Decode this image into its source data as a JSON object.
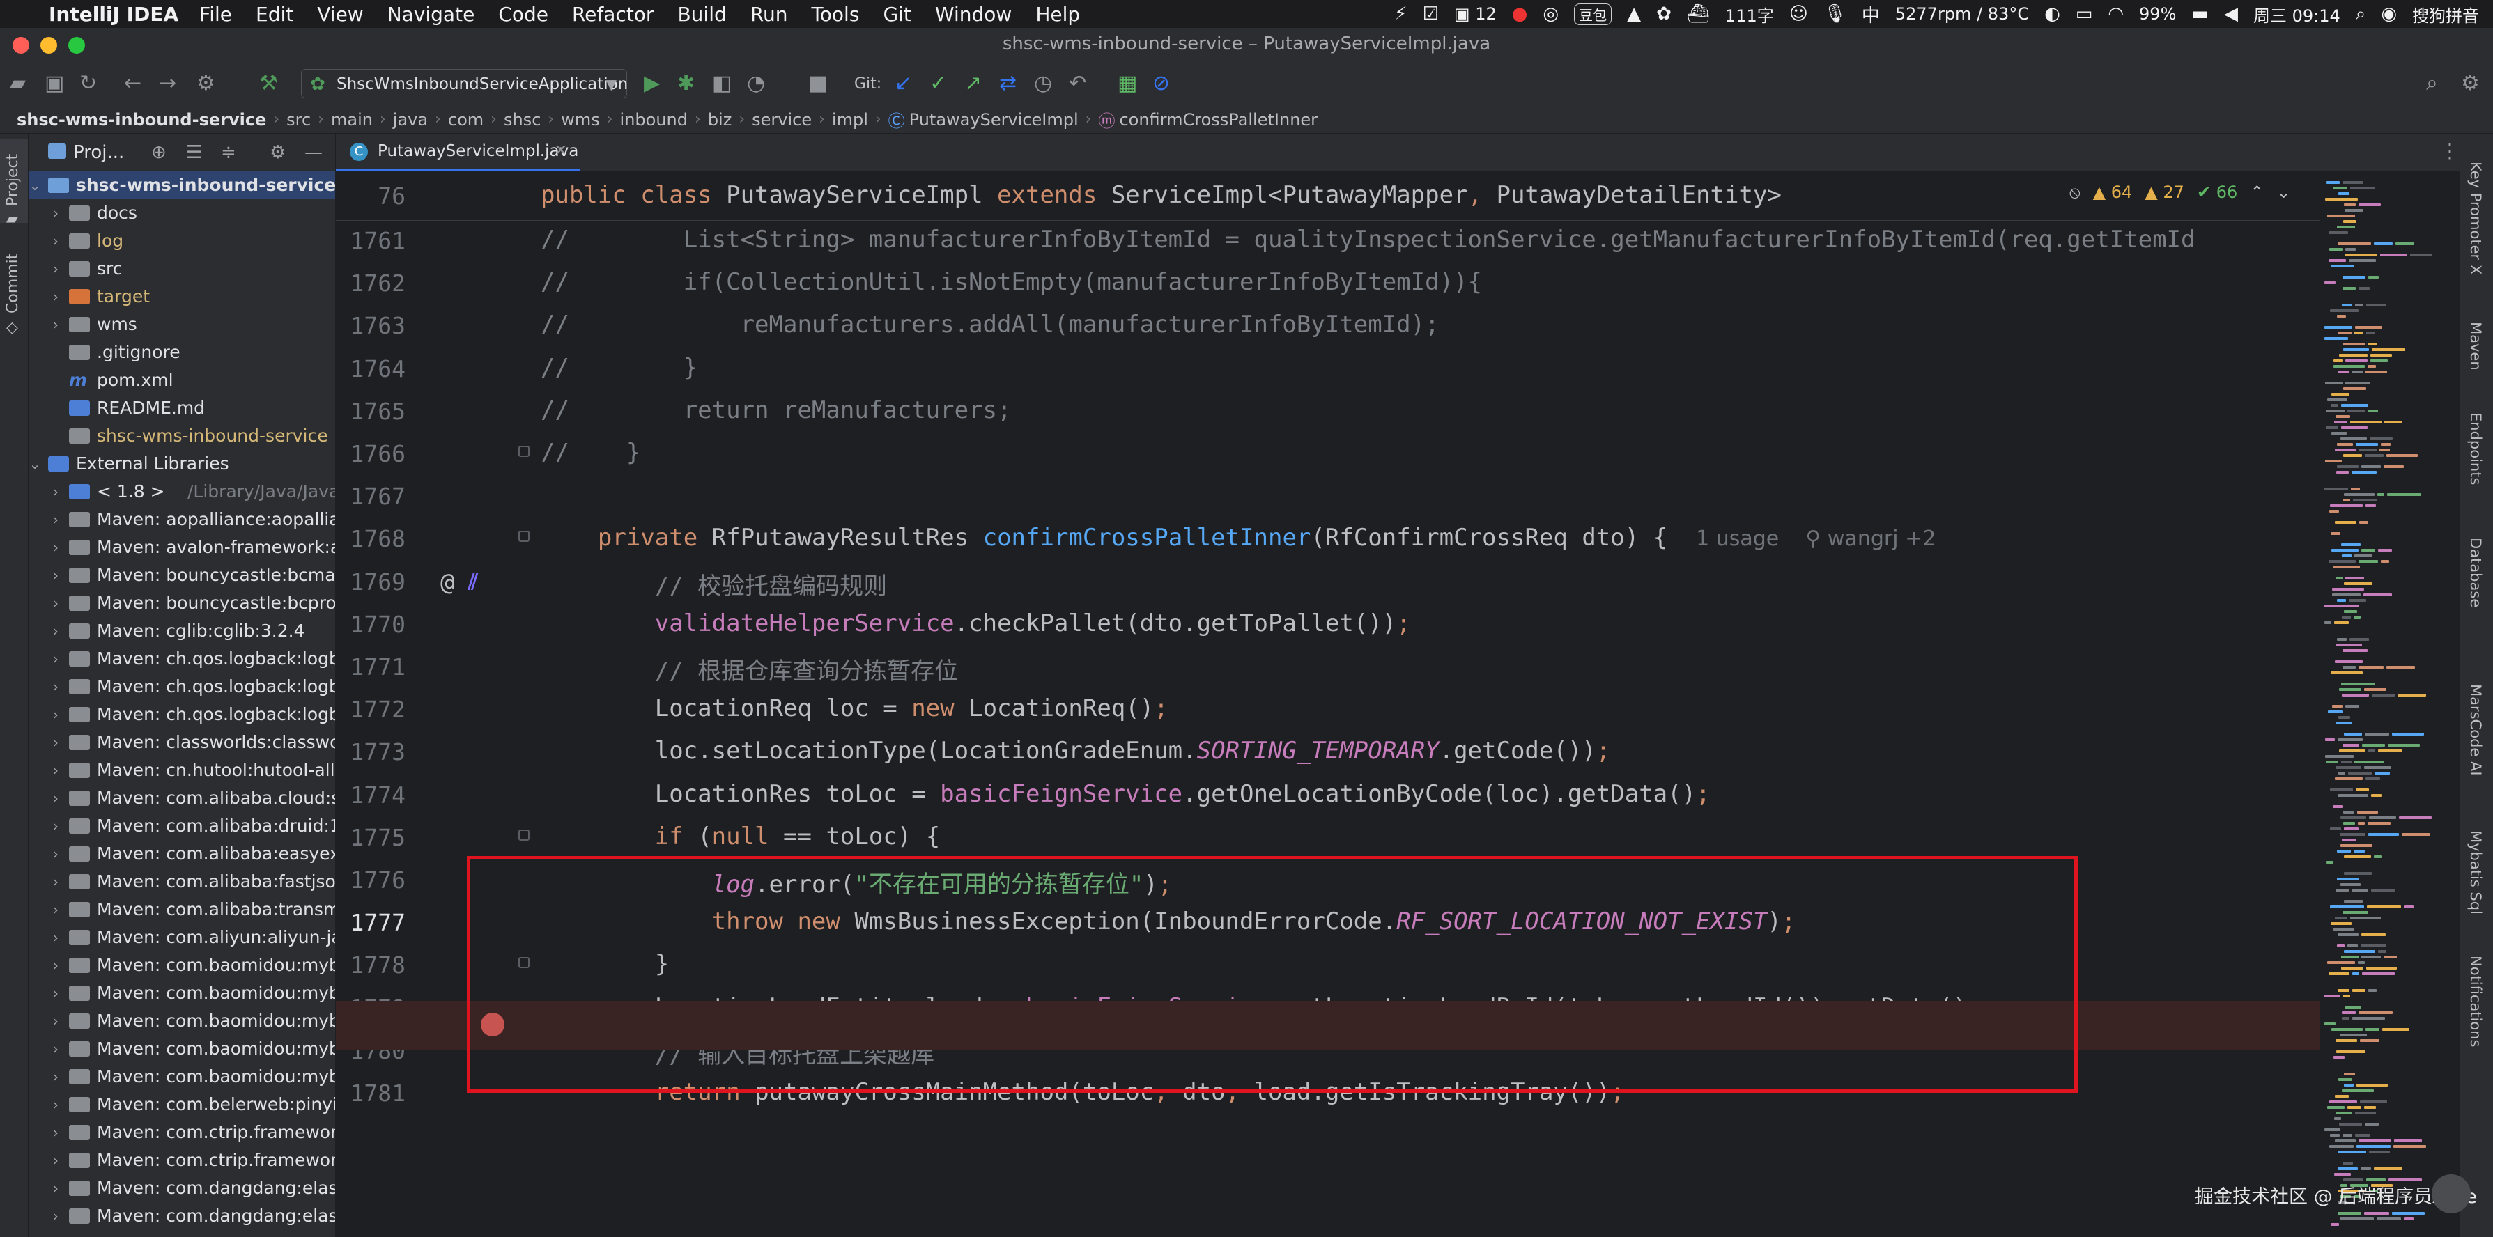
{
  "menubar": {
    "app": "IntelliJ IDEA",
    "items": [
      "File",
      "Edit",
      "View",
      "Navigate",
      "Code",
      "Refactor",
      "Build",
      "Run",
      "Tools",
      "Git",
      "Window",
      "Help"
    ],
    "status": {
      "notif_count": "12",
      "douban": "豆包",
      "word_count": "111字",
      "fan": "5277rpm / 83°C",
      "battery": "99%",
      "clock": "周三 09:14",
      "ime": "搜狗拼音"
    }
  },
  "window": {
    "title": "shsc-wms-inbound-service – PutawayServiceImpl.java"
  },
  "toolbar": {
    "run_config": "ShscWmsInboundServiceApplication",
    "git_label": "Git:"
  },
  "breadcrumb": [
    "shsc-wms-inbound-service",
    "src",
    "main",
    "java",
    "com",
    "shsc",
    "wms",
    "inbound",
    "biz",
    "service",
    "impl",
    "PutawayServiceImpl",
    "confirmCrossPalletInner"
  ],
  "project": {
    "header": "Proj...",
    "tree": [
      {
        "label": "shsc-wms-inbound-service",
        "depth": 0,
        "expanded": true,
        "kind": "module",
        "bold": true
      },
      {
        "label": "docs",
        "depth": 1,
        "expanded": false,
        "kind": "folder"
      },
      {
        "label": "log",
        "depth": 1,
        "expanded": false,
        "kind": "folder-excluded",
        "color": "#d5b778"
      },
      {
        "label": "src",
        "depth": 1,
        "expanded": false,
        "kind": "folder"
      },
      {
        "label": "target",
        "depth": 1,
        "expanded": false,
        "kind": "folder-target",
        "color": "#d5b778"
      },
      {
        "label": "wms",
        "depth": 1,
        "expanded": false,
        "kind": "folder"
      },
      {
        "label": ".gitignore",
        "depth": 1,
        "kind": "file"
      },
      {
        "label": "pom.xml",
        "depth": 1,
        "kind": "maven"
      },
      {
        "label": "README.md",
        "depth": 1,
        "kind": "md"
      },
      {
        "label": "shsc-wms-inbound-service",
        "depth": 1,
        "kind": "iml",
        "color": "#d5b778"
      },
      {
        "label": "External Libraries",
        "depth": 0,
        "expanded": true,
        "kind": "lib"
      },
      {
        "label": "< 1.8 >",
        "extra": "/Library/Java/JavaV",
        "depth": 1,
        "expanded": false,
        "kind": "jdk"
      },
      {
        "label": "Maven: aopalliance:aopallia",
        "depth": 1,
        "expanded": false,
        "kind": "jar"
      },
      {
        "label": "Maven: avalon-framework:a",
        "depth": 1,
        "expanded": false,
        "kind": "jar"
      },
      {
        "label": "Maven: bouncycastle:bcma",
        "depth": 1,
        "expanded": false,
        "kind": "jar"
      },
      {
        "label": "Maven: bouncycastle:bcpro",
        "depth": 1,
        "expanded": false,
        "kind": "jar"
      },
      {
        "label": "Maven: cglib:cglib:3.2.4",
        "depth": 1,
        "expanded": false,
        "kind": "jar"
      },
      {
        "label": "Maven: ch.qos.logback:logb",
        "depth": 1,
        "expanded": false,
        "kind": "jar"
      },
      {
        "label": "Maven: ch.qos.logback:logb",
        "depth": 1,
        "expanded": false,
        "kind": "jar"
      },
      {
        "label": "Maven: ch.qos.logback:logb",
        "depth": 1,
        "expanded": false,
        "kind": "jar"
      },
      {
        "label": "Maven: classworlds:classwo",
        "depth": 1,
        "expanded": false,
        "kind": "jar"
      },
      {
        "label": "Maven: cn.hutool:hutool-all",
        "depth": 1,
        "expanded": false,
        "kind": "jar"
      },
      {
        "label": "Maven: com.alibaba.cloud:s",
        "depth": 1,
        "expanded": false,
        "kind": "jar"
      },
      {
        "label": "Maven: com.alibaba:druid:1",
        "depth": 1,
        "expanded": false,
        "kind": "jar"
      },
      {
        "label": "Maven: com.alibaba:easyex",
        "depth": 1,
        "expanded": false,
        "kind": "jar"
      },
      {
        "label": "Maven: com.alibaba:fastjso",
        "depth": 1,
        "expanded": false,
        "kind": "jar"
      },
      {
        "label": "Maven: com.alibaba:transm",
        "depth": 1,
        "expanded": false,
        "kind": "jar"
      },
      {
        "label": "Maven: com.aliyun:aliyun-ja",
        "depth": 1,
        "expanded": false,
        "kind": "jar"
      },
      {
        "label": "Maven: com.baomidou:myb",
        "depth": 1,
        "expanded": false,
        "kind": "jar"
      },
      {
        "label": "Maven: com.baomidou:myb",
        "depth": 1,
        "expanded": false,
        "kind": "jar"
      },
      {
        "label": "Maven: com.baomidou:myb",
        "depth": 1,
        "expanded": false,
        "kind": "jar"
      },
      {
        "label": "Maven: com.baomidou:myb",
        "depth": 1,
        "expanded": false,
        "kind": "jar"
      },
      {
        "label": "Maven: com.baomidou:myb",
        "depth": 1,
        "expanded": false,
        "kind": "jar"
      },
      {
        "label": "Maven: com.belerweb:pinyi",
        "depth": 1,
        "expanded": false,
        "kind": "jar"
      },
      {
        "label": "Maven: com.ctrip.framewor",
        "depth": 1,
        "expanded": false,
        "kind": "jar"
      },
      {
        "label": "Maven: com.ctrip.framewor",
        "depth": 1,
        "expanded": false,
        "kind": "jar"
      },
      {
        "label": "Maven: com.dangdang:elas",
        "depth": 1,
        "expanded": false,
        "kind": "jar"
      },
      {
        "label": "Maven: com.dangdang:elas",
        "depth": 1,
        "expanded": false,
        "kind": "jar"
      }
    ]
  },
  "left_strip": {
    "project": "Project",
    "commit": "Commit"
  },
  "right_strip": [
    "Key Promoter X",
    "Maven",
    "Endpoints",
    "Database",
    "MarsCode AI",
    "Mybatis Sql",
    "Notifications"
  ],
  "editor": {
    "tab": "PutawayServiceImpl.java",
    "inspections": {
      "warnings": "64",
      "weak": "27",
      "ok": "66"
    },
    "sticky": {
      "line": "76"
    },
    "current_line": "1777",
    "breakpoint_line": "1777",
    "lines": [
      {
        "n": "1761",
        "tokens": [
          [
            "cm",
            "//        List<String> manufacturerInfoByItemId = qualityInspectionService.getManufacturerInfoByItemId(req.getItemId"
          ]
        ]
      },
      {
        "n": "1762",
        "tokens": [
          [
            "cm",
            "//        if(CollectionUtil.isNotEmpty(manufacturerInfoByItemId)){"
          ]
        ]
      },
      {
        "n": "1763",
        "tokens": [
          [
            "cm",
            "//            reManufacturers.addAll(manufacturerInfoByItemId);"
          ]
        ]
      },
      {
        "n": "1764",
        "tokens": [
          [
            "cm",
            "//        }"
          ]
        ]
      },
      {
        "n": "1765",
        "tokens": [
          [
            "cm",
            "//        return reManufacturers;"
          ]
        ]
      },
      {
        "n": "1766",
        "tokens": [
          [
            "cm",
            "//    }"
          ]
        ]
      },
      {
        "n": "1767",
        "tokens": []
      },
      {
        "n": "1768",
        "tokens": [
          [
            "",
            "    "
          ],
          [
            "kw",
            "private "
          ],
          [
            "",
            "RfPutawayResultRes "
          ],
          [
            "fn",
            "confirmCrossPalletInner"
          ],
          [
            "",
            "(RfConfirmCrossReq dto) {  "
          ],
          [
            "inlay",
            "1 usage    ⚲ wangrj +2"
          ]
        ]
      },
      {
        "n": "1769",
        "tokens": [
          [
            "",
            "        "
          ],
          [
            "cmt",
            "// 校验托盘编码规则"
          ]
        ]
      },
      {
        "n": "1770",
        "tokens": [
          [
            "",
            "        "
          ],
          [
            "fld",
            "validateHelperService"
          ],
          [
            "",
            ".checkPallet(dto.getToPallet())"
          ],
          [
            "kw",
            ";"
          ]
        ]
      },
      {
        "n": "1771",
        "tokens": [
          [
            "",
            "        "
          ],
          [
            "cmt",
            "// 根据仓库查询分拣暂存位"
          ]
        ]
      },
      {
        "n": "1772",
        "tokens": [
          [
            "",
            "        LocationReq loc = "
          ],
          [
            "kw",
            "new "
          ],
          [
            "",
            "LocationReq()"
          ],
          [
            "kw",
            ";"
          ]
        ]
      },
      {
        "n": "1773",
        "tokens": [
          [
            "",
            "        loc.setLocationType(LocationGradeEnum."
          ],
          [
            "itf",
            "SORTING_TEMPORARY"
          ],
          [
            "",
            ".getCode())"
          ],
          [
            "kw",
            ";"
          ]
        ]
      },
      {
        "n": "1774",
        "tokens": [
          [
            "",
            "        LocationRes toLoc = "
          ],
          [
            "fld",
            "basicFeignService"
          ],
          [
            "",
            ".getOneLocationByCode(loc).getData()"
          ],
          [
            "kw",
            ";"
          ]
        ]
      },
      {
        "n": "1775",
        "tokens": [
          [
            "",
            "        "
          ],
          [
            "kw",
            "if "
          ],
          [
            "",
            "("
          ],
          [
            "kw",
            "null "
          ],
          [
            "",
            "== toLoc) {"
          ]
        ]
      },
      {
        "n": "1776",
        "tokens": [
          [
            "",
            "            "
          ],
          [
            "itf",
            "log"
          ],
          [
            "",
            ".error("
          ],
          [
            "str",
            "\"不存在可用的分拣暂存位\""
          ],
          [
            "",
            ")"
          ],
          [
            "kw",
            ";"
          ]
        ]
      },
      {
        "n": "1777",
        "tokens": [
          [
            "",
            "            "
          ],
          [
            "kw",
            "throw new "
          ],
          [
            "",
            "WmsBusinessException(InboundErrorCode."
          ],
          [
            "itf",
            "RF_SORT_LOCATION_NOT_EXIST"
          ],
          [
            "",
            ")"
          ],
          [
            "kw",
            ";"
          ]
        ]
      },
      {
        "n": "1778",
        "tokens": [
          [
            "",
            "        }"
          ]
        ]
      },
      {
        "n": "1779",
        "tokens": [
          [
            "",
            "        LocationLoadEntity load = "
          ],
          [
            "fld",
            "basicFeignService"
          ],
          [
            "",
            ".getLocationLoadById(toLoc.getLoadId()).getData()"
          ],
          [
            "kw",
            ";"
          ]
        ]
      },
      {
        "n": "1780",
        "tokens": [
          [
            "",
            "        "
          ],
          [
            "cmt",
            "// 输入目标托盘上架越库"
          ]
        ]
      },
      {
        "n": "1781",
        "tokens": [
          [
            "",
            "        "
          ],
          [
            "kw",
            "return "
          ],
          [
            "",
            "putawayCrossMainMethod(toLoc"
          ],
          [
            "kw",
            ", "
          ],
          [
            "",
            "dto"
          ],
          [
            "kw",
            ", "
          ],
          [
            "",
            "load.getIsTrackingTray())"
          ],
          [
            "kw",
            ";"
          ]
        ]
      }
    ],
    "sticky_tokens": [
      [
        "kw",
        "public class "
      ],
      [
        "",
        "PutawayServiceImpl "
      ],
      [
        "kw",
        "extends "
      ],
      [
        "",
        "ServiceImpl<PutawayMapper"
      ],
      [
        "kw",
        ", "
      ],
      [
        "",
        "PutawayDetailEntity>"
      ]
    ]
  },
  "watermark": "掘金技术社区 @ 后端程序员Aske",
  "colors": {
    "accent": "#3574f0",
    "breakpoint": "#c75450",
    "highlight_box": "#e0141e"
  }
}
